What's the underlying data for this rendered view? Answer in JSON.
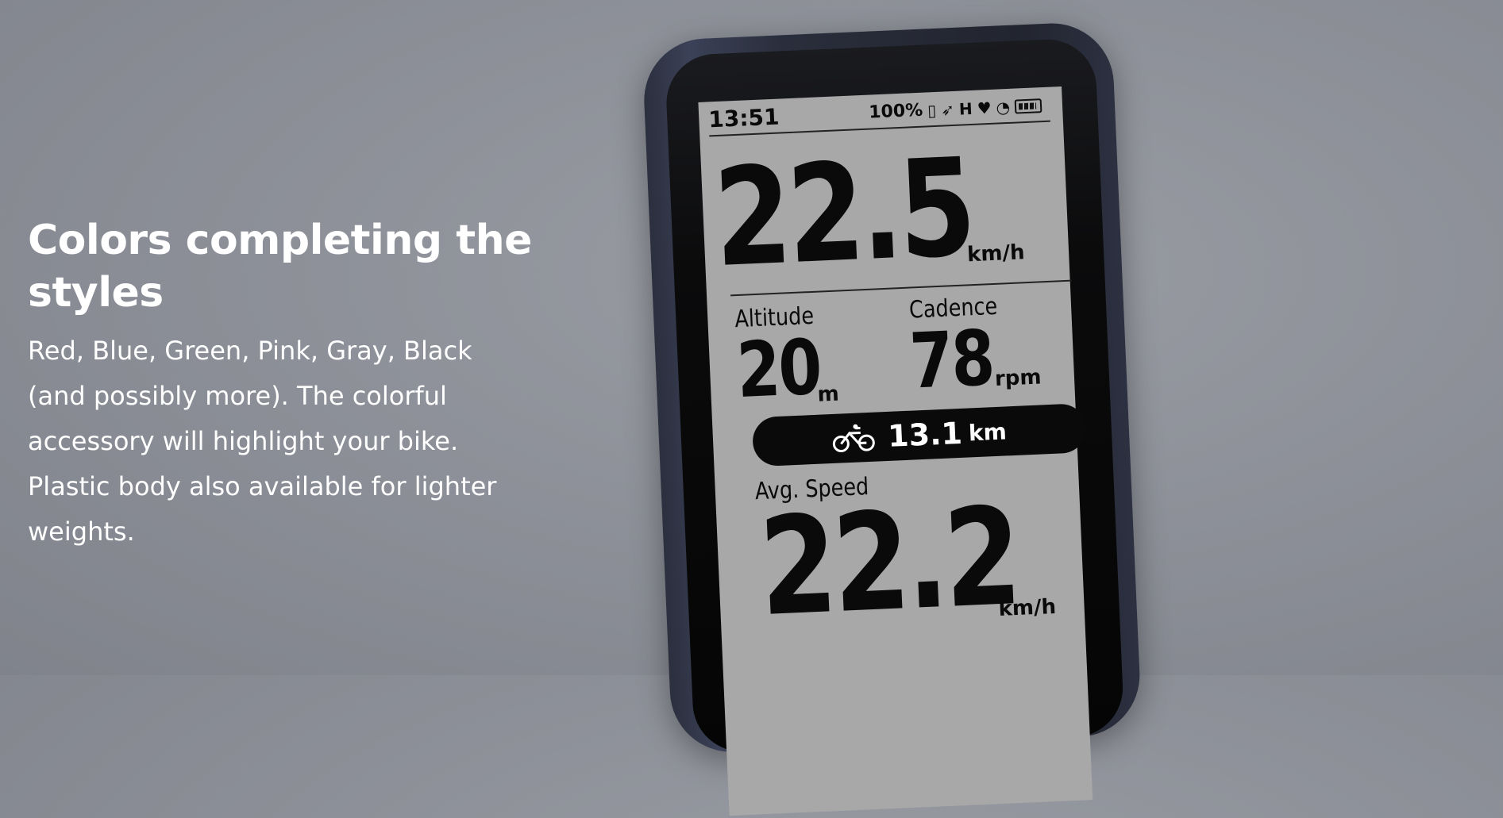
{
  "section": {
    "headline": "Colors completing the styles",
    "body": "Red, Blue, Green, Pink, Gray, Black (and possibly more). The colorful accessory will highlight your bike. Plastic body also available for lighter weights."
  },
  "device_screen": {
    "time": "13:51",
    "battery_percent": "100%",
    "status_icons": [
      "phone-icon",
      "gps-icon",
      "sensor-icon",
      "heart-icon",
      "speedometer-icon",
      "battery-icon"
    ],
    "speed": {
      "value": "22.5",
      "unit": "km/h"
    },
    "altitude": {
      "label": "Altitude",
      "value": "20",
      "unit": "m"
    },
    "cadence": {
      "label": "Cadence",
      "value": "78",
      "unit": "rpm"
    },
    "distance": {
      "value": "13.1",
      "unit": "km",
      "icon": "bicycle-icon"
    },
    "avg_speed": {
      "label": "Avg. Speed",
      "value": "22.2",
      "unit": "km/h"
    }
  }
}
